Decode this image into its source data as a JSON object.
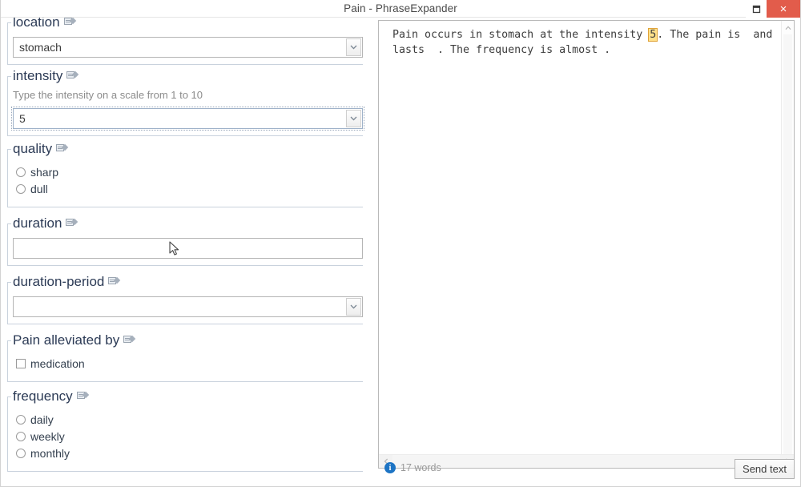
{
  "window": {
    "title": "Pain - PhraseExpander",
    "controls": {
      "restore_label": "Restore",
      "close_label": "×"
    }
  },
  "form": {
    "groups": [
      {
        "id": "location",
        "title": "location",
        "type": "combo",
        "value": "stomach",
        "hint": ""
      },
      {
        "id": "intensity",
        "title": "intensity",
        "type": "combo",
        "value": "5",
        "hint": "Type the intensity on a scale from 1 to 10",
        "focused": true
      },
      {
        "id": "quality",
        "title": "quality",
        "type": "radio",
        "options": [
          "sharp",
          "dull"
        ]
      },
      {
        "id": "duration",
        "title": "duration",
        "type": "text",
        "value": ""
      },
      {
        "id": "duration-period",
        "title": "duration-period",
        "type": "combo",
        "value": ""
      },
      {
        "id": "pain-alleviated-by",
        "title": "Pain alleviated by",
        "type": "checkbox",
        "options": [
          "medication"
        ]
      },
      {
        "id": "frequency",
        "title": "frequency",
        "type": "radio",
        "options": [
          "daily",
          "weekly",
          "monthly"
        ]
      }
    ]
  },
  "preview": {
    "text_before_highlight": "Pain occurs in stomach at the intensity ",
    "highlight": "5",
    "text_after_highlight": ". The pain is  and lasts  . The frequency is almost ."
  },
  "status": {
    "info_icon": "info-icon",
    "word_count": "17 words",
    "send_label": "Send text"
  },
  "colors": {
    "close_red": "#e25c4b",
    "group_title": "#2b3a55",
    "highlight_bg": "#ffe08a",
    "highlight_border": "#e0a33a",
    "info_blue": "#1d74c4"
  }
}
